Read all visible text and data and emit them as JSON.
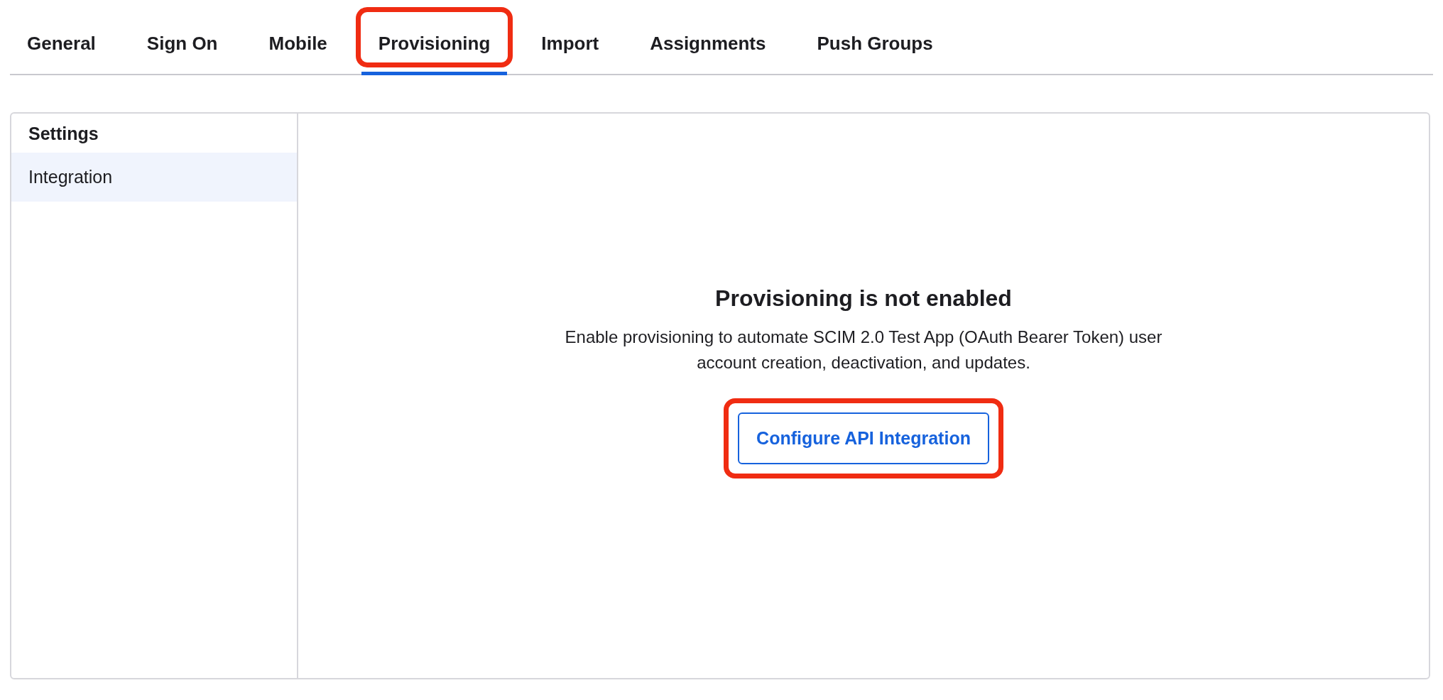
{
  "tabs": [
    {
      "label": "General",
      "selected": false,
      "highlighted": false
    },
    {
      "label": "Sign On",
      "selected": false,
      "highlighted": false
    },
    {
      "label": "Mobile",
      "selected": false,
      "highlighted": false
    },
    {
      "label": "Provisioning",
      "selected": true,
      "highlighted": true
    },
    {
      "label": "Import",
      "selected": false,
      "highlighted": false
    },
    {
      "label": "Assignments",
      "selected": false,
      "highlighted": false
    },
    {
      "label": "Push Groups",
      "selected": false,
      "highlighted": false
    }
  ],
  "sidebar": {
    "heading": "Settings",
    "items": [
      {
        "label": "Integration",
        "selected": true
      }
    ]
  },
  "main": {
    "title": "Provisioning is not enabled",
    "description": "Enable provisioning to automate SCIM 2.0 Test App (OAuth Bearer Token) user account creation, deactivation, and updates.",
    "button": {
      "label": "Configure API Integration",
      "highlighted": true
    }
  }
}
